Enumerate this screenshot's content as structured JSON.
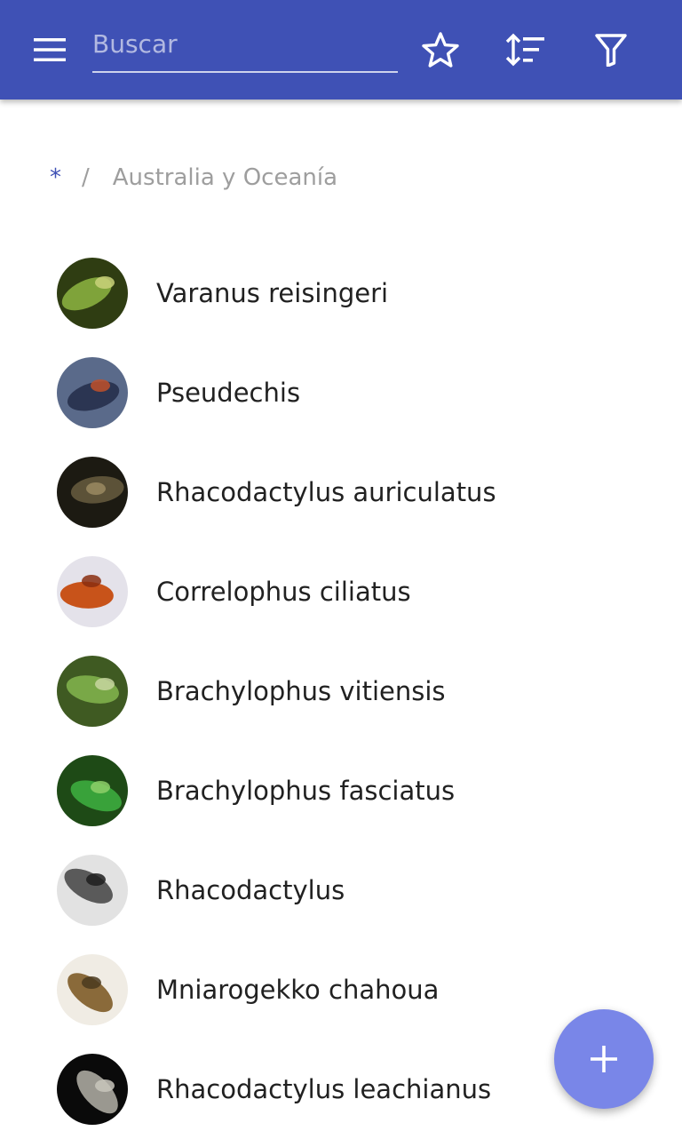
{
  "colors": {
    "primary": "#3f51b5",
    "accent": "#7986e8",
    "text": "#212121",
    "muted": "#9e9e9e"
  },
  "appbar": {
    "menu_icon": "menu-icon",
    "search_placeholder": "Buscar",
    "search_value": "",
    "favorite_icon": "star-outline-icon",
    "sort_icon": "sort-icon",
    "filter_icon": "filter-icon"
  },
  "breadcrumb": {
    "root": "*",
    "separator": "/",
    "current": "Australia y Oceanía"
  },
  "species": [
    {
      "name": "Varanus reisingeri",
      "avatar_colors": [
        "#2f3d12",
        "#7fa33a",
        "#c9d27a"
      ]
    },
    {
      "name": "Pseudechis",
      "avatar_colors": [
        "#5a6a8a",
        "#2b3552",
        "#c0502a"
      ]
    },
    {
      "name": "Rhacodactylus auriculatus",
      "avatar_colors": [
        "#1c1a12",
        "#5c5238",
        "#9a8a62"
      ]
    },
    {
      "name": "Correlophus ciliatus",
      "avatar_colors": [
        "#e4e2ea",
        "#c8531a",
        "#8a2e10"
      ]
    },
    {
      "name": "Brachylophus vitiensis",
      "avatar_colors": [
        "#3f5a22",
        "#79a847",
        "#c7d6a0"
      ]
    },
    {
      "name": "Brachylophus fasciatus",
      "avatar_colors": [
        "#1e4a16",
        "#39a23a",
        "#8ed06a"
      ]
    },
    {
      "name": "Rhacodactylus",
      "avatar_colors": [
        "#e2e2e2",
        "#5a5a5a",
        "#1f1f1f"
      ]
    },
    {
      "name": "Mniarogekko chahoua",
      "avatar_colors": [
        "#f0ece4",
        "#8a6a3a",
        "#4a3a1e"
      ]
    },
    {
      "name": "Rhacodactylus leachianus",
      "avatar_colors": [
        "#0a0a0a",
        "#9a9890",
        "#c8c6bc"
      ]
    }
  ],
  "fab": {
    "icon": "plus-icon"
  }
}
